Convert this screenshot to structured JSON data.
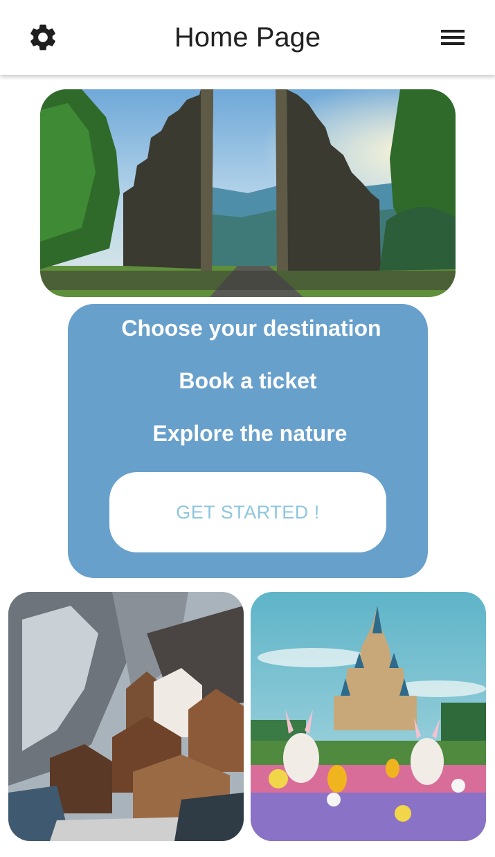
{
  "header": {
    "title": "Home Page",
    "settings_icon": "gear-icon",
    "menu_icon": "hamburger-menu-icon"
  },
  "hero": {
    "image": "bali-temple-gate-photo"
  },
  "card": {
    "line1": "Choose your destination",
    "line2": "Book a ticket",
    "line3": "Explore the nature",
    "button_label": "GET STARTED !",
    "background": "#68a0cc",
    "button_text_color": "#8dc6dd"
  },
  "gallery": {
    "left_image": "alpine-village-photo",
    "right_image": "castle-flower-garden-photo"
  }
}
